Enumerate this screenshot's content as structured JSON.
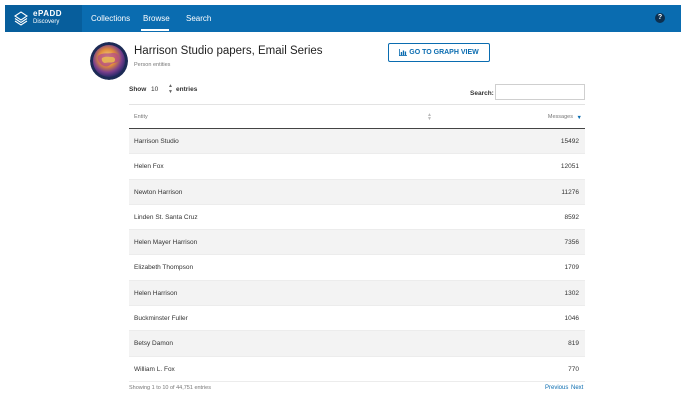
{
  "app": {
    "logo_line1": "ePADD",
    "logo_line2": "Discovery",
    "logo_icon": "stacked-pages-icon"
  },
  "nav": {
    "collections": "Collections",
    "browse": "Browse",
    "search": "Search",
    "active": "browse",
    "help_icon": "question-circle-icon",
    "help_glyph": "?"
  },
  "header": {
    "title": "Harrison Studio papers, Email Series",
    "subtitle": "Person entities",
    "graph_button": "GO TO GRAPH VIEW",
    "graph_icon": "bar-chart-icon"
  },
  "controls": {
    "show_label": "Show",
    "page_size": "10",
    "entries_label": "entries",
    "search_label": "Search:",
    "search_value": ""
  },
  "table": {
    "columns": {
      "entity": "Entity",
      "messages": "Messages"
    },
    "sort": {
      "column": "messages",
      "direction": "descending"
    },
    "rows": [
      {
        "entity": "Harrison Studio",
        "messages": "15492"
      },
      {
        "entity": "Helen Fox",
        "messages": "12051"
      },
      {
        "entity": "Newton Harrison",
        "messages": "11276"
      },
      {
        "entity": "Linden St. Santa Cruz",
        "messages": "8592"
      },
      {
        "entity": "Helen Mayer Harrison",
        "messages": "7356"
      },
      {
        "entity": "Elizabeth Thompson",
        "messages": "1709"
      },
      {
        "entity": "Helen Harrison",
        "messages": "1302"
      },
      {
        "entity": "Buckminster Fuller",
        "messages": "1046"
      },
      {
        "entity": "Betsy Damon",
        "messages": "819"
      },
      {
        "entity": "William L. Fox",
        "messages": "770"
      }
    ]
  },
  "footer": {
    "info": "Showing 1 to 10 of 44,751 entries",
    "previous": "Previous",
    "next": "Next"
  },
  "colors": {
    "topbar": "#0a6cb0",
    "logo_block": "#075e9c",
    "accent": "#0a6cb0",
    "row_stripe": "#f3f3f3"
  }
}
